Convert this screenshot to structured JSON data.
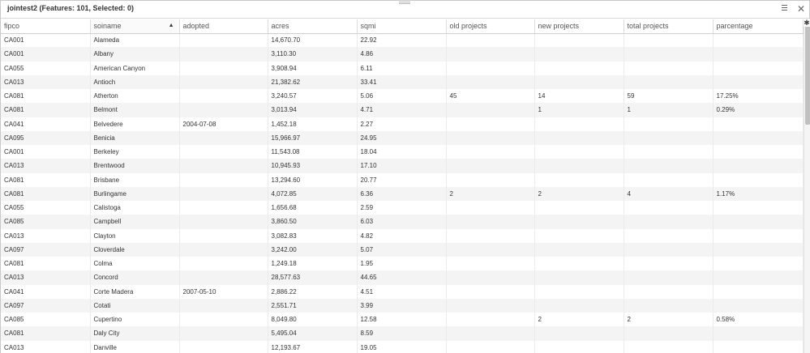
{
  "window": {
    "title": "jointest2 (Features: 101, Selected: 0)",
    "icons": {
      "menu": "hamburger-icon",
      "close": "close-icon",
      "columns": "gear-icon"
    }
  },
  "table": {
    "columns": [
      "fipco",
      "soiname",
      "adopted",
      "acres",
      "sqmi",
      "old projects",
      "new projects",
      "total projects",
      "parcentage"
    ],
    "sorted_column": "soiname",
    "sort_direction": "ascending",
    "rows": [
      [
        "CA001",
        "Alameda",
        "",
        "14,670.70",
        "22.92",
        "",
        "",
        "",
        ""
      ],
      [
        "CA001",
        "Albany",
        "",
        "3,110.30",
        "4.86",
        "",
        "",
        "",
        ""
      ],
      [
        "CA055",
        "American Canyon",
        "",
        "3,908.94",
        "6.11",
        "",
        "",
        "",
        ""
      ],
      [
        "CA013",
        "Antioch",
        "",
        "21,382.62",
        "33.41",
        "",
        "",
        "",
        ""
      ],
      [
        "CA081",
        "Atherton",
        "",
        "3,240.57",
        "5.06",
        "45",
        "14",
        "59",
        "17.25%"
      ],
      [
        "CA081",
        "Belmont",
        "",
        "3,013.94",
        "4.71",
        "",
        "1",
        "1",
        "0.29%"
      ],
      [
        "CA041",
        "Belvedere",
        "2004-07-08",
        "1,452.18",
        "2.27",
        "",
        "",
        "",
        ""
      ],
      [
        "CA095",
        "Benicia",
        "",
        "15,966.97",
        "24.95",
        "",
        "",
        "",
        ""
      ],
      [
        "CA001",
        "Berkeley",
        "",
        "11,543.08",
        "18.04",
        "",
        "",
        "",
        ""
      ],
      [
        "CA013",
        "Brentwood",
        "",
        "10,945.93",
        "17.10",
        "",
        "",
        "",
        ""
      ],
      [
        "CA081",
        "Brisbane",
        "",
        "13,294.60",
        "20.77",
        "",
        "",
        "",
        ""
      ],
      [
        "CA081",
        "Burlingame",
        "",
        "4,072.85",
        "6.36",
        "2",
        "2",
        "4",
        "1.17%"
      ],
      [
        "CA055",
        "Calistoga",
        "",
        "1,656.68",
        "2.59",
        "",
        "",
        "",
        ""
      ],
      [
        "CA085",
        "Campbell",
        "",
        "3,860.50",
        "6.03",
        "",
        "",
        "",
        ""
      ],
      [
        "CA013",
        "Clayton",
        "",
        "3,082.83",
        "4.82",
        "",
        "",
        "",
        ""
      ],
      [
        "CA097",
        "Cloverdale",
        "",
        "3,242.00",
        "5.07",
        "",
        "",
        "",
        ""
      ],
      [
        "CA081",
        "Colma",
        "",
        "1,249.18",
        "1.95",
        "",
        "",
        "",
        ""
      ],
      [
        "CA013",
        "Concord",
        "",
        "28,577.63",
        "44.65",
        "",
        "",
        "",
        ""
      ],
      [
        "CA041",
        "Corte Madera",
        "2007-05-10",
        "2,886.22",
        "4.51",
        "",
        "",
        "",
        ""
      ],
      [
        "CA097",
        "Cotati",
        "",
        "2,551.71",
        "3.99",
        "",
        "",
        "",
        ""
      ],
      [
        "CA085",
        "Cupertino",
        "",
        "8,049.80",
        "12.58",
        "",
        "2",
        "2",
        "0.58%"
      ],
      [
        "CA081",
        "Daly City",
        "",
        "5,495.04",
        "8.59",
        "",
        "",
        "",
        ""
      ],
      [
        "CA013",
        "Danville",
        "",
        "12,193.67",
        "19.05",
        "",
        "",
        "",
        ""
      ]
    ]
  }
}
